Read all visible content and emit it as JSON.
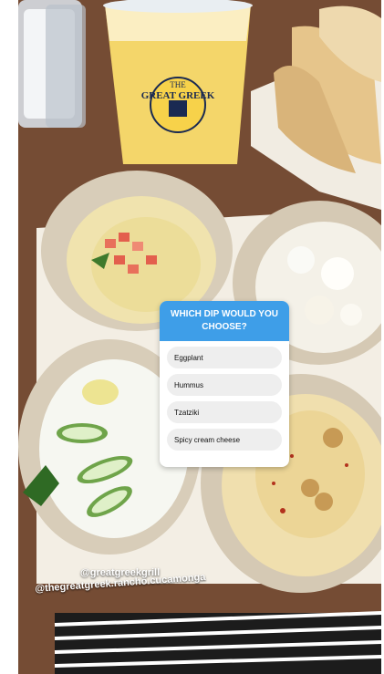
{
  "poll": {
    "question": "WHICH DIP WOULD YOU CHOOSE?",
    "options": [
      "Eggplant",
      "Hummus",
      "Tzatziki",
      "Spicy cream cheese"
    ]
  },
  "captions": [
    "@greatgreekgrill",
    "@thegreatgreek.rancho.cucamonga"
  ],
  "cup_text": [
    "THE",
    "GREAT GREEK"
  ],
  "colors": {
    "poll_header": "#3e9ee8",
    "poll_bg": "#ffffff"
  }
}
